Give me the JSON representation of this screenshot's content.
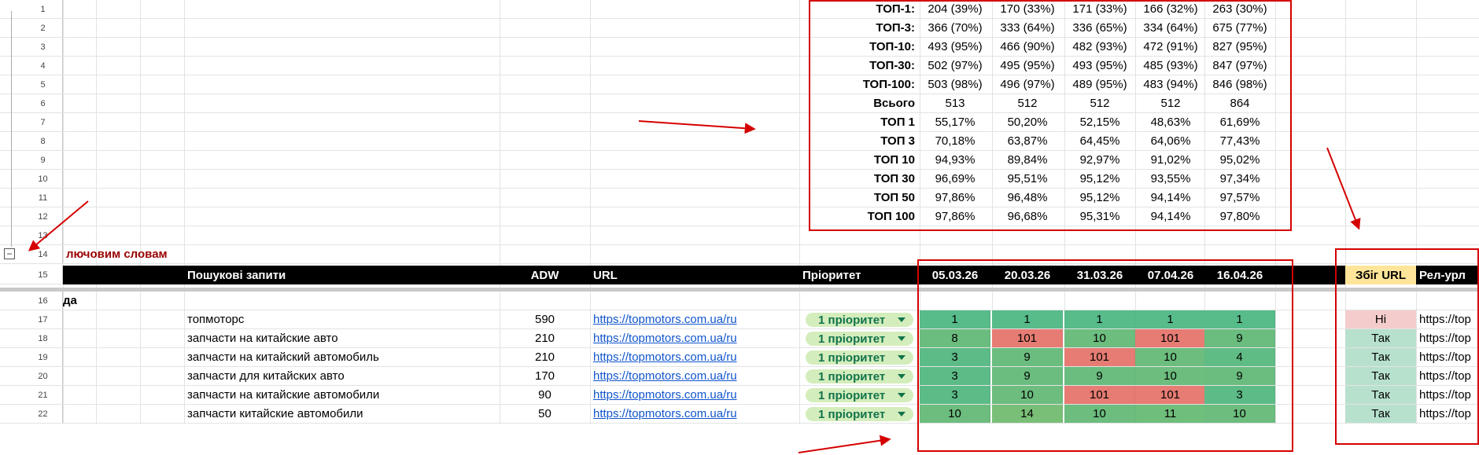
{
  "top_stats": [
    {
      "row": "1",
      "label": "ТОП-1:",
      "values": [
        "204 (39%)",
        "170 (33%)",
        "171 (33%)",
        "166 (32%)",
        "263 (30%)"
      ]
    },
    {
      "row": "2",
      "label": "ТОП-3:",
      "values": [
        "366 (70%)",
        "333 (64%)",
        "336 (65%)",
        "334 (64%)",
        "675 (77%)"
      ]
    },
    {
      "row": "3",
      "label": "ТОП-10:",
      "values": [
        "493 (95%)",
        "466 (90%)",
        "482 (93%)",
        "472 (91%)",
        "827 (95%)"
      ]
    },
    {
      "row": "4",
      "label": "ТОП-30:",
      "values": [
        "502 (97%)",
        "495 (95%)",
        "493 (95%)",
        "485 (93%)",
        "847 (97%)"
      ]
    },
    {
      "row": "5",
      "label": "ТОП-100:",
      "values": [
        "503 (98%)",
        "496 (97%)",
        "489 (95%)",
        "483 (94%)",
        "846 (98%)"
      ]
    },
    {
      "row": "6",
      "label": "Всього",
      "values": [
        "513",
        "512",
        "512",
        "512",
        "864"
      ]
    },
    {
      "row": "7",
      "label": "ТОП 1",
      "values": [
        "55,17%",
        "50,20%",
        "52,15%",
        "48,63%",
        "61,69%"
      ]
    },
    {
      "row": "8",
      "label": "ТОП 3",
      "values": [
        "70,18%",
        "63,87%",
        "64,45%",
        "64,06%",
        "77,43%"
      ]
    },
    {
      "row": "9",
      "label": "ТОП 10",
      "values": [
        "94,93%",
        "89,84%",
        "92,97%",
        "91,02%",
        "95,02%"
      ]
    },
    {
      "row": "10",
      "label": "ТОП 30",
      "values": [
        "96,69%",
        "95,51%",
        "95,12%",
        "93,55%",
        "97,34%"
      ]
    },
    {
      "row": "11",
      "label": "ТОП 50",
      "values": [
        "97,86%",
        "96,48%",
        "95,12%",
        "94,14%",
        "97,57%"
      ]
    },
    {
      "row": "12",
      "label": "ТОП 100",
      "values": [
        "97,86%",
        "96,68%",
        "95,31%",
        "94,14%",
        "97,80%"
      ]
    }
  ],
  "row13": "13",
  "row14": {
    "num": "14",
    "title": "лючовим словам"
  },
  "header": {
    "num": "15",
    "queries": "Пошукові запити",
    "adw": "ADW",
    "url": "URL",
    "priority": "Пріоритет",
    "dates": [
      "05.03.26",
      "20.03.26",
      "31.03.26",
      "07.04.26",
      "16.04.26"
    ],
    "url_match": "Збіг URL",
    "rel_url": "Рел-урл"
  },
  "row16": {
    "num": "16",
    "text": "да"
  },
  "keywords": [
    {
      "num": "17",
      "query": "топмоторс",
      "adw": "590",
      "url": "https://topmotors.com.ua/ru",
      "priority": "1 пріоритет",
      "positions": [
        "1",
        "1",
        "1",
        "1",
        "1"
      ],
      "colors": [
        "#57bb8a",
        "#57bb8a",
        "#57bb8a",
        "#57bb8a",
        "#57bb8a"
      ],
      "match": "Ні",
      "match_color": "#f4cccc",
      "rel": "https://top"
    },
    {
      "num": "18",
      "query": "запчасти на китайские авто",
      "adw": "210",
      "url": "https://topmotors.com.ua/ru",
      "priority": "1 пріоритет",
      "positions": [
        "8",
        "101",
        "10",
        "101",
        "9"
      ],
      "colors": [
        "#6bbd7f",
        "#e67c73",
        "#6cbd7e",
        "#e67c73",
        "#6bbd7f"
      ],
      "match": "Так",
      "match_color": "#b7e1cd",
      "rel": "https://top"
    },
    {
      "num": "19",
      "query": "запчасти на китайский автомобиль",
      "adw": "210",
      "url": "https://topmotors.com.ua/ru",
      "priority": "1 пріоритет",
      "positions": [
        "3",
        "9",
        "101",
        "10",
        "4"
      ],
      "colors": [
        "#5cbb87",
        "#6bbd7f",
        "#e67c73",
        "#6cbd7e",
        "#60bc85"
      ],
      "match": "Так",
      "match_color": "#b7e1cd",
      "rel": "https://top"
    },
    {
      "num": "20",
      "query": "запчасти для китайских авто",
      "adw": "170",
      "url": "https://topmotors.com.ua/ru",
      "priority": "1 пріоритет",
      "positions": [
        "3",
        "9",
        "9",
        "10",
        "9"
      ],
      "colors": [
        "#5cbb87",
        "#6bbd7f",
        "#6bbd7f",
        "#6cbd7e",
        "#6bbd7f"
      ],
      "match": "Так",
      "match_color": "#b7e1cd",
      "rel": "https://top"
    },
    {
      "num": "21",
      "query": "запчасти на китайские автомобили",
      "adw": "90",
      "url": "https://topmotors.com.ua/ru",
      "priority": "1 пріоритет",
      "positions": [
        "3",
        "10",
        "101",
        "101",
        "3"
      ],
      "colors": [
        "#5cbb87",
        "#6cbd7e",
        "#e67c73",
        "#e67c73",
        "#5cbb87"
      ],
      "match": "Так",
      "match_color": "#b7e1cd",
      "rel": "https://top"
    },
    {
      "num": "22",
      "query": "запчасти китайские автомобили",
      "adw": "50",
      "url": "https://topmotors.com.ua/ru",
      "priority": "1 пріоритет",
      "positions": [
        "10",
        "14",
        "10",
        "11",
        "10"
      ],
      "colors": [
        "#6cbd7e",
        "#7abf77",
        "#6cbd7e",
        "#70be7c",
        "#6cbd7e"
      ],
      "match": "Так",
      "match_color": "#b7e1cd",
      "rel": "https://top"
    }
  ],
  "colors": {
    "annotation_red": "#d50000",
    "header_bg": "#000000",
    "match_header_bg": "#ffe599",
    "section_title": "#990000"
  },
  "icons": {
    "collapse": "minus-square-icon"
  }
}
